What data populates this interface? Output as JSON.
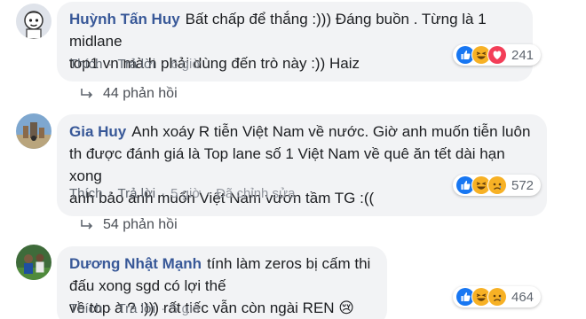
{
  "comments": [
    {
      "author": "Huỳnh Tấn Huy",
      "lines": [
        "Bất chấp để thắng :))) Đáng buồn . Từng là 1 midlane",
        "top1 vn mà h phải dùng đến trò này :)) Haiz"
      ],
      "actions": {
        "like": "Thích",
        "reply": "Trả lời",
        "time": "6 giờ"
      },
      "reaction_count": "241",
      "reaction_icons": [
        "like-icon",
        "haha-icon",
        "love-icon"
      ],
      "replies": "44 phản hồi"
    },
    {
      "author": "Gia Huy",
      "lines": [
        "Anh xoáy R tiễn Việt Nam về nước. Giờ anh muốn tiễn luôn",
        "th được đánh giá là Top lane số 1 Việt Nam về quê ăn tết dài hạn xong",
        "anh bảo anh muốn Việt Nam vươn tầm TG :(("
      ],
      "actions": {
        "like": "Thích",
        "reply": "Trả lời",
        "time": "5 giờ",
        "edited": "Đã chỉnh sửa"
      },
      "reaction_count": "572",
      "reaction_icons": [
        "like-icon",
        "haha-icon",
        "sad-icon"
      ],
      "replies": "54 phản hồi"
    },
    {
      "author": "Dương Nhật Mạnh",
      "lines": [
        "tính làm zeros bị cấm thi đấu xong sgd có lợi thế",
        "về top à ? :))) rất tiếc vẫn còn ngài REN 😢"
      ],
      "actions": {
        "like": "Thích",
        "reply": "Trả lời",
        "time": "5 giờ"
      },
      "reaction_count": "464",
      "reaction_icons": [
        "like-icon",
        "haha-icon",
        "sad-icon"
      ]
    }
  ],
  "colors": {
    "author": "#385898",
    "bubble": "#f2f3f5",
    "like": "#1877f2",
    "love": "#f33e58",
    "haha": "#f7b125"
  }
}
